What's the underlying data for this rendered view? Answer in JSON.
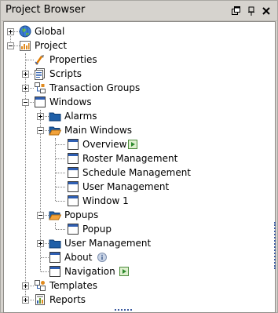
{
  "panel": {
    "title": "Project Browser"
  },
  "tree": {
    "global": "Global",
    "project": "Project",
    "properties": "Properties",
    "scripts": "Scripts",
    "transaction_groups": "Transaction Groups",
    "windows": "Windows",
    "alarms": "Alarms",
    "main_windows": "Main Windows",
    "overview": "Overview",
    "roster_management": "Roster Management",
    "schedule_management": "Schedule Management",
    "user_management_window": "User Management",
    "window1": "Window 1",
    "popups": "Popups",
    "popup": "Popup",
    "user_management_folder": "User Management",
    "about": "About",
    "navigation": "Navigation",
    "templates": "Templates",
    "reports": "Reports"
  }
}
